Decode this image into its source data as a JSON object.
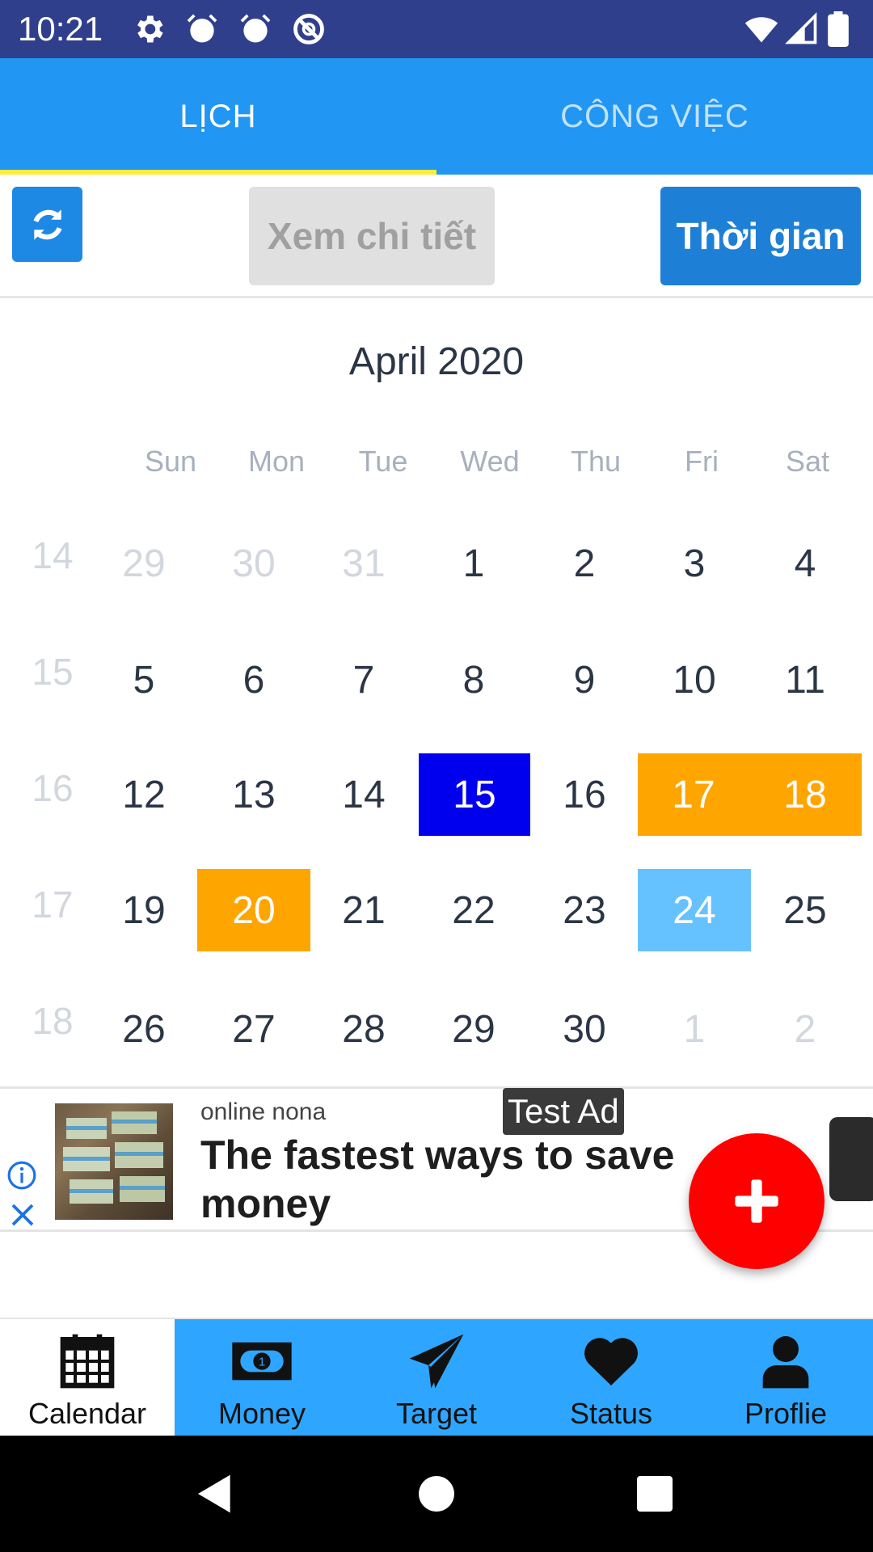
{
  "status_bar": {
    "time": "10:21",
    "icons": [
      "gear-icon",
      "alarm-icon",
      "alarm-icon",
      "do-not-disturb-icon",
      "wifi-icon",
      "signal-icon",
      "battery-icon"
    ]
  },
  "tabs": [
    {
      "label": "LỊCH",
      "active": true
    },
    {
      "label": "CÔNG VIỆC",
      "active": false
    }
  ],
  "toolbar": {
    "refresh_icon": "refresh-icon",
    "detail_label": "Xem chi tiết",
    "time_label": "Thời gian"
  },
  "calendar": {
    "month_title": "April 2020",
    "weekdays": [
      "Sun",
      "Mon",
      "Tue",
      "Wed",
      "Thu",
      "Fri",
      "Sat"
    ],
    "weeks": [
      {
        "week": "14",
        "days": [
          "29",
          "30",
          "31",
          "1",
          "2",
          "3",
          "4"
        ]
      },
      {
        "week": "15",
        "days": [
          "5",
          "6",
          "7",
          "8",
          "9",
          "10",
          "11"
        ]
      },
      {
        "week": "16",
        "days": [
          "12",
          "13",
          "14",
          "15",
          "16",
          "17",
          "18"
        ]
      },
      {
        "week": "17",
        "days": [
          "19",
          "20",
          "21",
          "22",
          "23",
          "24",
          "25"
        ]
      },
      {
        "week": "18",
        "days": [
          "26",
          "27",
          "28",
          "29",
          "30",
          "1",
          "2"
        ]
      }
    ],
    "highlights": {
      "today_blue": "#0000EE",
      "event_orange": "#FFA500",
      "selected_light_blue": "#66C2FF"
    }
  },
  "ad": {
    "label": "Test Ad",
    "source": "online nona",
    "headline": "The fastest ways to save money"
  },
  "fab": {
    "icon": "plus-icon",
    "color": "#FF0000"
  },
  "bottom_nav": [
    {
      "label": "Calendar",
      "icon": "calendar-icon",
      "active": true
    },
    {
      "label": "Money",
      "icon": "money-icon",
      "active": false
    },
    {
      "label": "Target",
      "icon": "paper-plane-icon",
      "active": false
    },
    {
      "label": "Status",
      "icon": "heart-icon",
      "active": false
    },
    {
      "label": "Proflie",
      "icon": "person-icon",
      "active": false
    }
  ],
  "colors": {
    "status_bar": "#303F8C",
    "primary": "#2196F3",
    "accent_indicator": "#FFEB3B",
    "bottom_nav": "#2EA6FF"
  }
}
